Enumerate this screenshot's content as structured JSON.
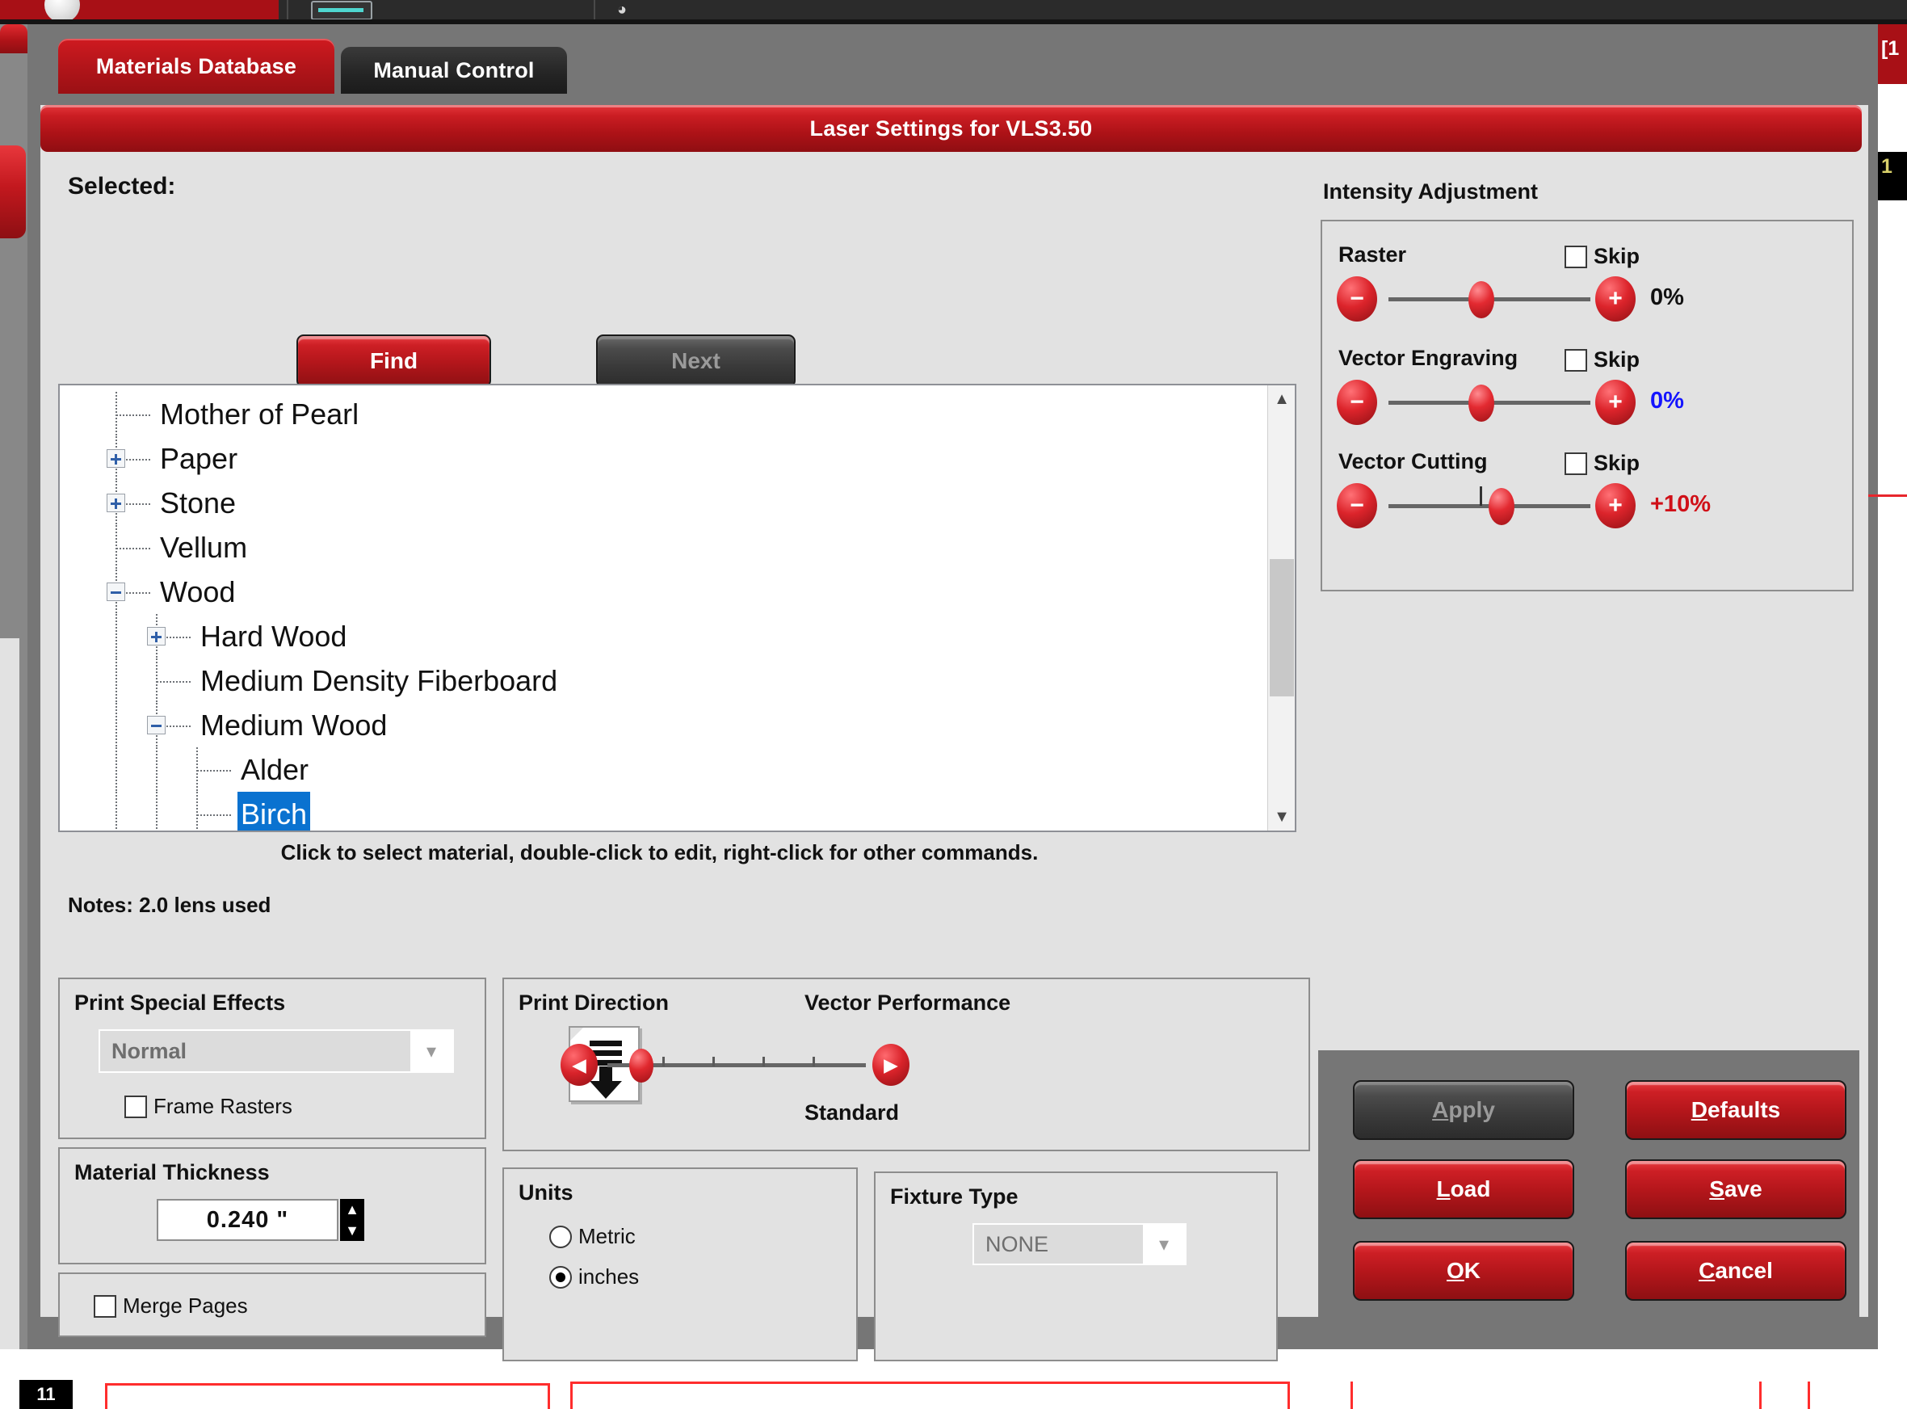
{
  "toolbar": {
    "logo_icon": "app-logo-icon",
    "meter_icon": "laser-meter-icon",
    "glyph_icon": "print-head-icon"
  },
  "tabs": [
    {
      "label": "Materials Database",
      "active": true
    },
    {
      "label": "Manual Control",
      "active": false
    }
  ],
  "dialog": {
    "title": "Laser Settings for VLS3.50",
    "selected_label": "Selected:",
    "selected_value": "",
    "find_button": "Find",
    "next_button": "Next",
    "hint": "Click to select material, double-click to edit, right-click for other commands.",
    "notes": "Notes: 2.0 lens used"
  },
  "tree": {
    "items": [
      {
        "label": "Mother of Pearl",
        "depth": 1,
        "toggle": "none",
        "selected": false
      },
      {
        "label": "Paper",
        "depth": 1,
        "toggle": "plus",
        "selected": false
      },
      {
        "label": "Stone",
        "depth": 1,
        "toggle": "plus",
        "selected": false
      },
      {
        "label": "Vellum",
        "depth": 1,
        "toggle": "none",
        "selected": false
      },
      {
        "label": "Wood",
        "depth": 1,
        "toggle": "minus",
        "selected": false
      },
      {
        "label": "Hard Wood",
        "depth": 2,
        "toggle": "plus",
        "selected": false
      },
      {
        "label": "Medium Density Fiberboard",
        "depth": 2,
        "toggle": "none",
        "selected": false
      },
      {
        "label": "Medium Wood",
        "depth": 2,
        "toggle": "minus",
        "selected": false
      },
      {
        "label": "Alder",
        "depth": 3,
        "toggle": "none",
        "selected": false
      },
      {
        "label": "Birch",
        "depth": 3,
        "toggle": "none",
        "selected": true
      }
    ],
    "scroll_up_icon": "chevron-up-icon",
    "scroll_down_icon": "chevron-down-icon"
  },
  "intensity": {
    "title": "Intensity Adjustment",
    "skip_label": "Skip",
    "minus_icon": "minus-circle-icon",
    "plus_icon": "plus-circle-icon",
    "rows": [
      {
        "label": "Raster",
        "value": "0%",
        "value_color": "#111111",
        "skip_checked": false,
        "thumb_pct": 46,
        "center_tick": false
      },
      {
        "label": "Vector Engraving",
        "value": "0%",
        "value_color": "#1414ff",
        "skip_checked": false,
        "thumb_pct": 46,
        "center_tick": false
      },
      {
        "label": "Vector Cutting",
        "value": "+10%",
        "value_color": "#d01018",
        "skip_checked": false,
        "thumb_pct": 56,
        "center_tick": true
      }
    ]
  },
  "print_special_effects": {
    "title": "Print Special Effects",
    "selected": "Normal",
    "dropdown_icon": "chevron-down-icon",
    "frame_rasters_label": "Frame Rasters",
    "frame_rasters_checked": false
  },
  "material_thickness": {
    "title": "Material Thickness",
    "value": "0.240 \"",
    "up_icon": "spinner-up-icon",
    "down_icon": "spinner-down-icon"
  },
  "merge_pages": {
    "label": "Merge Pages",
    "checked": false
  },
  "print_direction": {
    "title": "Print Direction",
    "icon": "page-down-arrow-icon"
  },
  "vector_performance": {
    "title": "Vector Performance",
    "value": "Standard",
    "left_icon": "arrow-left-circle-icon",
    "right_icon": "arrow-right-circle-icon",
    "thumb_pct": 13
  },
  "units": {
    "title": "Units",
    "options": [
      {
        "label": "Metric",
        "selected": false
      },
      {
        "label": "inches",
        "selected": true
      }
    ]
  },
  "fixture_type": {
    "title": "Fixture Type",
    "selected": "NONE",
    "dropdown_icon": "chevron-down-icon"
  },
  "actions": {
    "apply": {
      "label": "Apply",
      "mnemonic": "A",
      "enabled": false
    },
    "defaults": {
      "label": "Defaults",
      "mnemonic": "D",
      "enabled": true
    },
    "load": {
      "label": "Load",
      "mnemonic": "L",
      "enabled": true
    },
    "save": {
      "label": "Save",
      "mnemonic": "S",
      "enabled": true
    },
    "ok": {
      "label": "OK",
      "mnemonic": "O",
      "enabled": true
    },
    "cancel": {
      "label": "Cancel",
      "mnemonic": "C",
      "enabled": true
    }
  },
  "status": {
    "page_badge": "11",
    "right_tab_label": "[1",
    "right_black_label": "1"
  },
  "colors": {
    "accent_red": "#c2181e",
    "panel_gray": "#e2e2e2",
    "frame_gray": "#767676",
    "selection_blue": "#0a72d0"
  }
}
